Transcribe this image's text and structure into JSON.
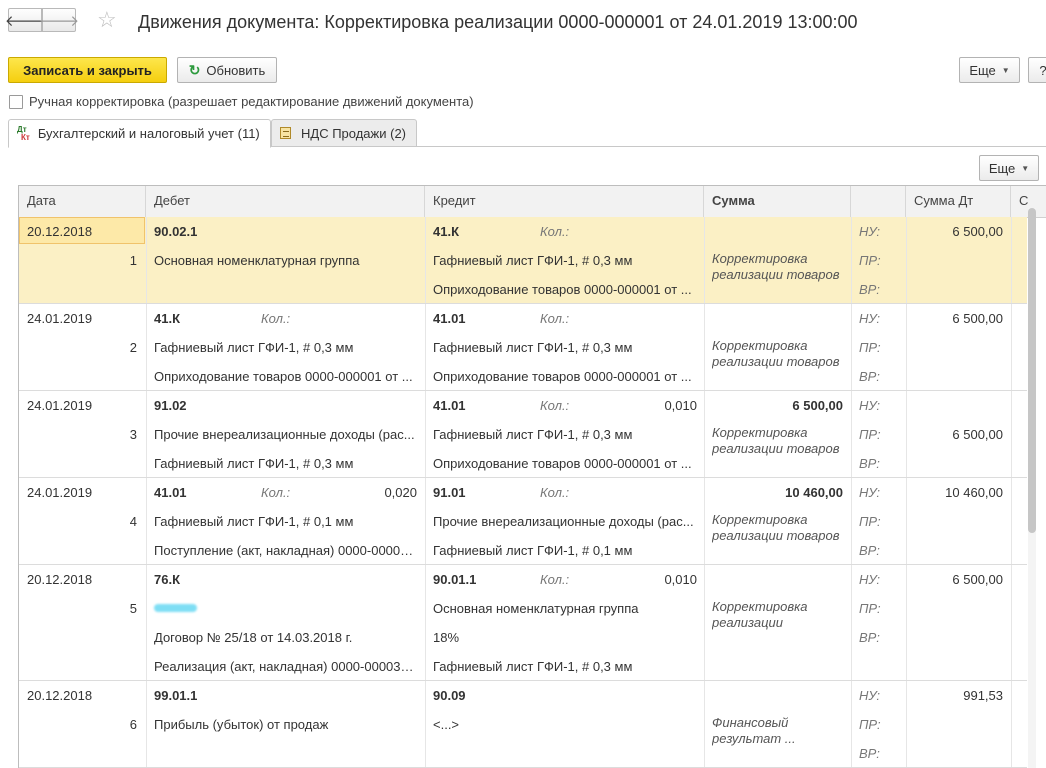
{
  "window": {
    "title": "Движения документа: Корректировка реализации 0000-000001 от 24.01.2019 13:00:00",
    "back_glyph": "🡐",
    "forward_glyph": "🡒",
    "star_glyph": "☆"
  },
  "toolbar": {
    "save_close_label": "Записать и закрыть",
    "refresh_label": "Обновить",
    "more_label": "Еще",
    "help_label": "?"
  },
  "manual_correction": {
    "label": "Ручная корректировка (разрешает редактирование движений документа)",
    "checked": false
  },
  "tabs": [
    {
      "label": "Бухгалтерский и налоговый учет (11)",
      "icon": "dt-kt-icon",
      "active": true,
      "icon_dt": "Дт",
      "icon_kt": "Кт"
    },
    {
      "label": "НДС Продажи (2)",
      "icon": "vat-icon",
      "active": false
    }
  ],
  "grid": {
    "more_label": "Еще",
    "columns": [
      "Дата",
      "Дебет",
      "Кредит",
      "Сумма",
      "",
      "Сумма Дт",
      "С"
    ],
    "rows": [
      {
        "date": "20.12.2018",
        "n": "1",
        "debit": [
          "90.02.1",
          "Основная номенклатурная группа",
          ""
        ],
        "debit_qty_label": "",
        "debit_qty": "",
        "credit": [
          "41.К",
          "Гафниевый лист ГФИ-1, # 0,3 мм",
          "Оприходование товаров 0000-000001 от ..."
        ],
        "credit_qty_label": "Кол.:",
        "credit_qty": "",
        "amount": "",
        "content": "Корректировка реализации товаров",
        "tax": [
          "НУ:",
          "ПР:",
          "ВР:"
        ],
        "sum_dt": "6 500,00",
        "sum_dt_pr": "",
        "selected": true
      },
      {
        "date": "24.01.2019",
        "n": "2",
        "debit": [
          "41.К",
          "Гафниевый лист ГФИ-1, # 0,3 мм",
          "Оприходование товаров 0000-000001 от ..."
        ],
        "debit_qty_label": "Кол.:",
        "debit_qty": "",
        "credit": [
          "41.01",
          "Гафниевый лист ГФИ-1, # 0,3 мм",
          "Оприходование товаров 0000-000001 от ..."
        ],
        "credit_qty_label": "Кол.:",
        "credit_qty": "",
        "amount": "",
        "content": "Корректировка реализации товаров",
        "tax": [
          "НУ:",
          "ПР:",
          "ВР:"
        ],
        "sum_dt": "6 500,00",
        "sum_dt_pr": "",
        "selected": false
      },
      {
        "date": "24.01.2019",
        "n": "3",
        "debit": [
          "91.02",
          "Прочие внереализационные доходы (рас...",
          "Гафниевый лист ГФИ-1, # 0,3 мм"
        ],
        "debit_qty_label": "",
        "debit_qty": "",
        "credit": [
          "41.01",
          "Гафниевый лист ГФИ-1, # 0,3 мм",
          "Оприходование товаров 0000-000001 от ..."
        ],
        "credit_qty_label": "Кол.:",
        "credit_qty": "0,010",
        "amount": "6 500,00",
        "content": "Корректировка реализации товаров",
        "tax": [
          "НУ:",
          "ПР:",
          "ВР:"
        ],
        "sum_dt": "",
        "sum_dt_pr": "6 500,00",
        "selected": false
      },
      {
        "date": "24.01.2019",
        "n": "4",
        "debit": [
          "41.01",
          "Гафниевый лист ГФИ-1, # 0,1 мм",
          "Поступление (акт, накладная) 0000-00003..."
        ],
        "debit_qty_label": "Кол.:",
        "debit_qty": "0,020",
        "credit": [
          "91.01",
          "Прочие внереализационные доходы (рас...",
          "Гафниевый лист ГФИ-1, # 0,1 мм"
        ],
        "credit_qty_label": "Кол.:",
        "credit_qty": "",
        "amount": "10 460,00",
        "content": "Корректировка реализации товаров",
        "tax": [
          "НУ:",
          "ПР:",
          "ВР:"
        ],
        "sum_dt": "10 460,00",
        "sum_dt_pr": "",
        "selected": false
      },
      {
        "date": "20.12.2018",
        "n": "5",
        "debit": [
          "76.К",
          "",
          "Договор № 25/18 от 14.03.2018 г.",
          "Реализация (акт, накладная) 0000-000037..."
        ],
        "debit_qty_label": "",
        "debit_qty": "",
        "credit": [
          "90.01.1",
          "Основная номенклатурная группа",
          "18%",
          "Гафниевый лист ГФИ-1, # 0,3 мм"
        ],
        "credit_qty_label": "Кол.:",
        "credit_qty": "0,010",
        "amount": "",
        "content": "Корректировка реализации",
        "tax": [
          "НУ:",
          "ПР:",
          "ВР:"
        ],
        "sum_dt": "6 500,00",
        "sum_dt_pr": "",
        "selected": false
      },
      {
        "date": "20.12.2018",
        "n": "6",
        "debit": [
          "99.01.1",
          "Прибыль (убыток) от продаж",
          ""
        ],
        "debit_qty_label": "",
        "debit_qty": "",
        "credit": [
          "90.09",
          "<...>",
          ""
        ],
        "credit_qty_label": "",
        "credit_qty": "",
        "amount": "",
        "content": "Финансовый результат ...",
        "tax": [
          "НУ:",
          "ПР:",
          "ВР:"
        ],
        "sum_dt": "991,53",
        "sum_dt_pr": "",
        "selected": false
      }
    ]
  }
}
